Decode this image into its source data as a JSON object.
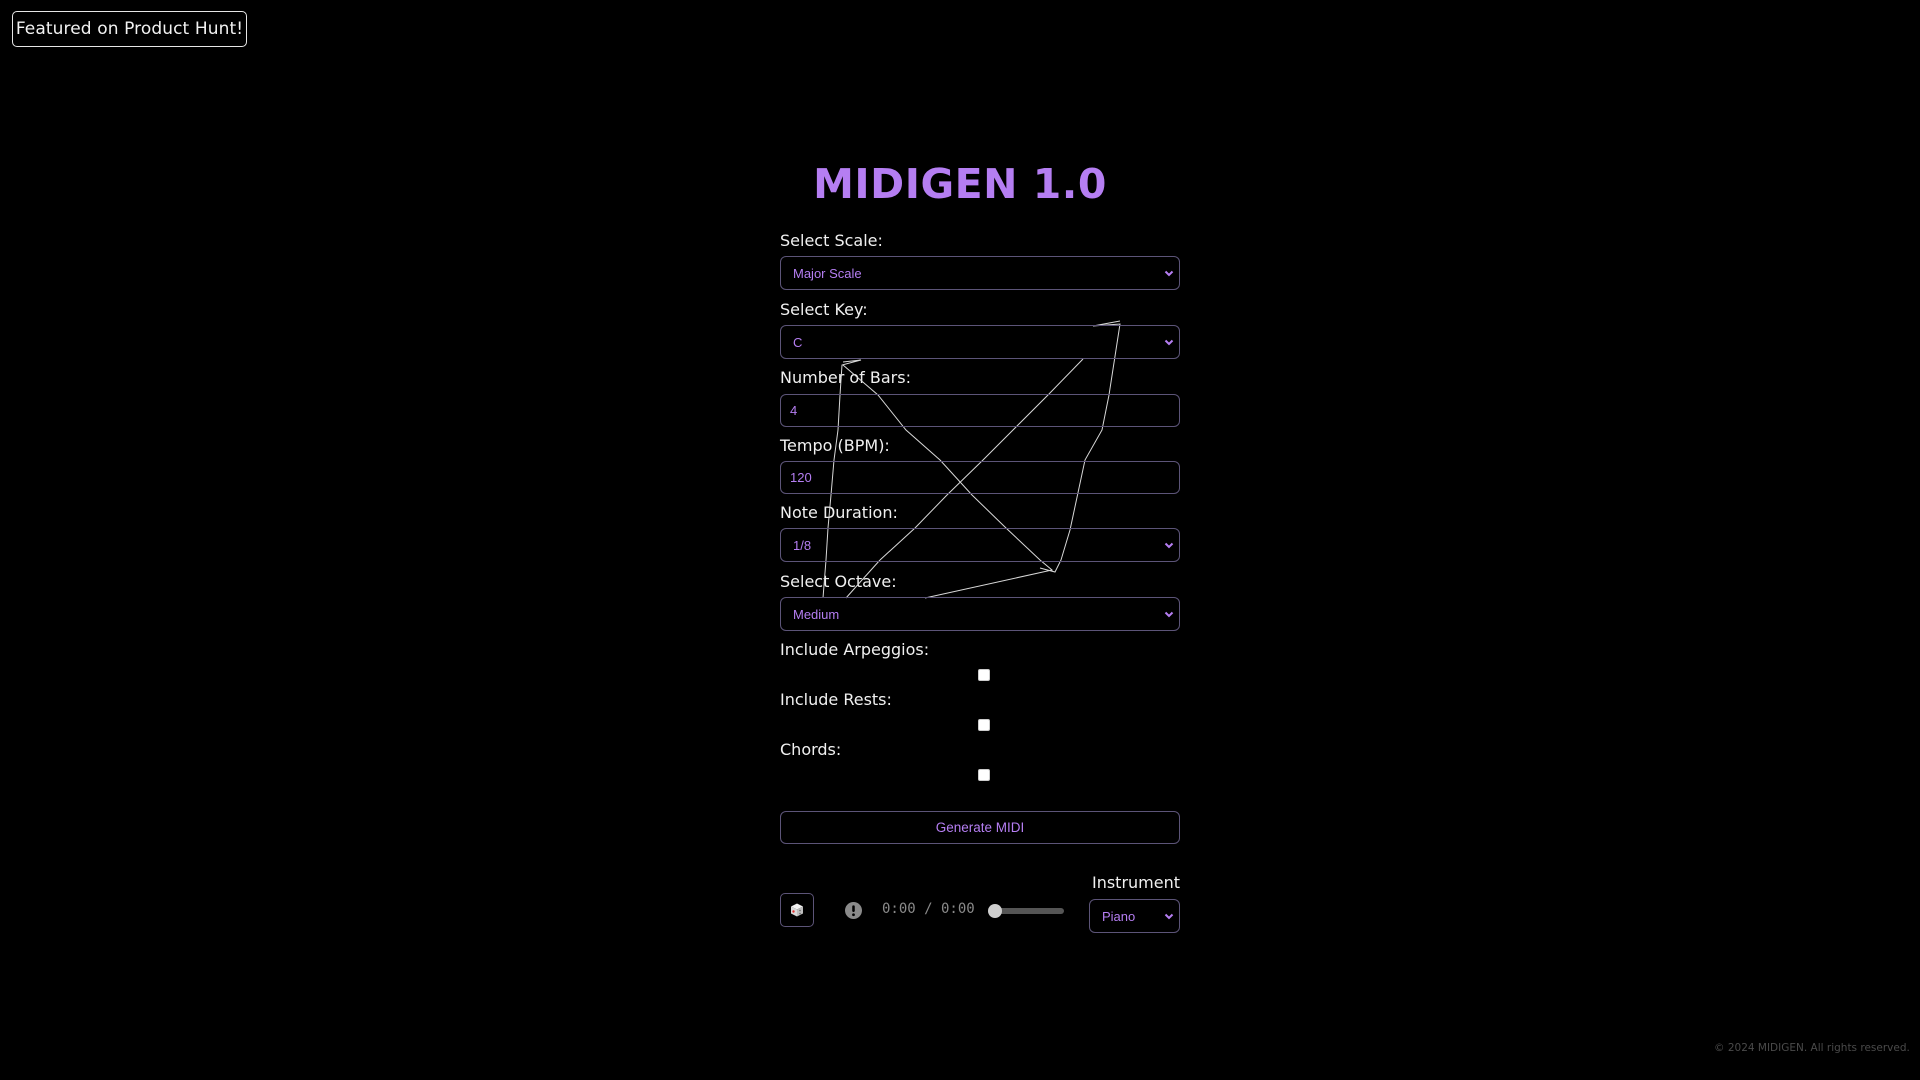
{
  "badge": {
    "label": "Featured on Product Hunt!"
  },
  "header": {
    "title": "MIDIGEN 1.0"
  },
  "form": {
    "scale": {
      "label": "Select Scale:",
      "value": "Major Scale"
    },
    "key": {
      "label": "Select Key:",
      "value": "C"
    },
    "bars": {
      "label": "Number of Bars:",
      "value": "4"
    },
    "tempo": {
      "label": "Tempo (BPM):",
      "value": "120"
    },
    "duration": {
      "label": "Note Duration:",
      "value": "1/8"
    },
    "octave": {
      "label": "Select Octave:",
      "value": "Medium"
    },
    "arpeggios": {
      "label": "Include Arpeggios:",
      "checked": false
    },
    "rests": {
      "label": "Include Rests:",
      "checked": false
    },
    "chords": {
      "label": "Chords:",
      "checked": false
    },
    "generate_label": "Generate MIDI"
  },
  "player": {
    "dice_icon": "dice-icon",
    "status_icon": "alert-circle-icon",
    "time": "0:00 / 0:00",
    "progress": 0,
    "instrument_label": "Instrument",
    "instrument_value": "Piano"
  },
  "footer": {
    "text": "© 2024 MIDIGEN. All rights reserved."
  },
  "colors": {
    "accent": "#b57ef2",
    "border": "#5c5478",
    "background": "#000000"
  }
}
